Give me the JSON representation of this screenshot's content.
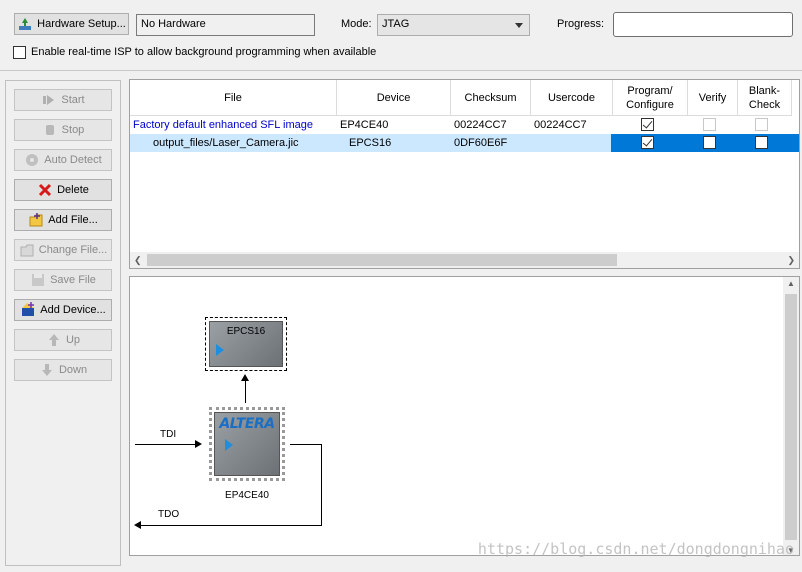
{
  "toolbar": {
    "hardware_setup_label": "Hardware Setup...",
    "hardware_value": "No Hardware",
    "mode_label": "Mode:",
    "mode_value": "JTAG",
    "progress_label": "Progress:",
    "progress_value": "",
    "isp_checkbox_label": "Enable real-time ISP to allow background programming when available",
    "isp_checked": false
  },
  "side_buttons": [
    {
      "label": "Start",
      "icon": "play-icon",
      "enabled": false
    },
    {
      "label": "Stop",
      "icon": "stop-hand-icon",
      "enabled": false
    },
    {
      "label": "Auto Detect",
      "icon": "auto-detect-icon",
      "enabled": false
    },
    {
      "label": "Delete",
      "icon": "red-x-icon",
      "enabled": true
    },
    {
      "label": "Add File...",
      "icon": "add-file-icon",
      "enabled": true
    },
    {
      "label": "Change File...",
      "icon": "change-file-icon",
      "enabled": false
    },
    {
      "label": "Save File",
      "icon": "save-file-icon",
      "enabled": false
    },
    {
      "label": "Add Device...",
      "icon": "add-device-icon",
      "enabled": true
    },
    {
      "label": "Up",
      "icon": "up-arrow-icon",
      "enabled": false
    },
    {
      "label": "Down",
      "icon": "down-arrow-icon",
      "enabled": false
    }
  ],
  "table": {
    "headers": {
      "file": "File",
      "device": "Device",
      "checksum": "Checksum",
      "usercode": "Usercode",
      "program_l1": "Program/",
      "program_l2": "Configure",
      "verify": "Verify",
      "blank_l1": "Blank-",
      "blank_l2": "Check"
    },
    "rows": [
      {
        "file": "Factory default enhanced SFL image",
        "device": "EP4CE40",
        "checksum": "00224CC7",
        "usercode": "00224CC7",
        "program": true,
        "verify": false,
        "blank": false,
        "selected": false
      },
      {
        "file": "output_files/Laser_Camera.jic",
        "device": "EPCS16",
        "checksum": "0DF60E6F",
        "usercode": "",
        "program": true,
        "verify": false,
        "blank": false,
        "selected": true
      }
    ]
  },
  "diagram": {
    "flash_chip_label": "EPCS16",
    "fpga_logo": "ALTERA",
    "fpga_label": "EP4CE40",
    "tdi_label": "TDI",
    "tdo_label": "TDO"
  },
  "watermark": "https://blog.csdn.net/dongdongnihao",
  "colors": {
    "selected_row": "#cce8ff",
    "selected_highlight": "#0078d7",
    "link_blue": "#0000cc"
  }
}
